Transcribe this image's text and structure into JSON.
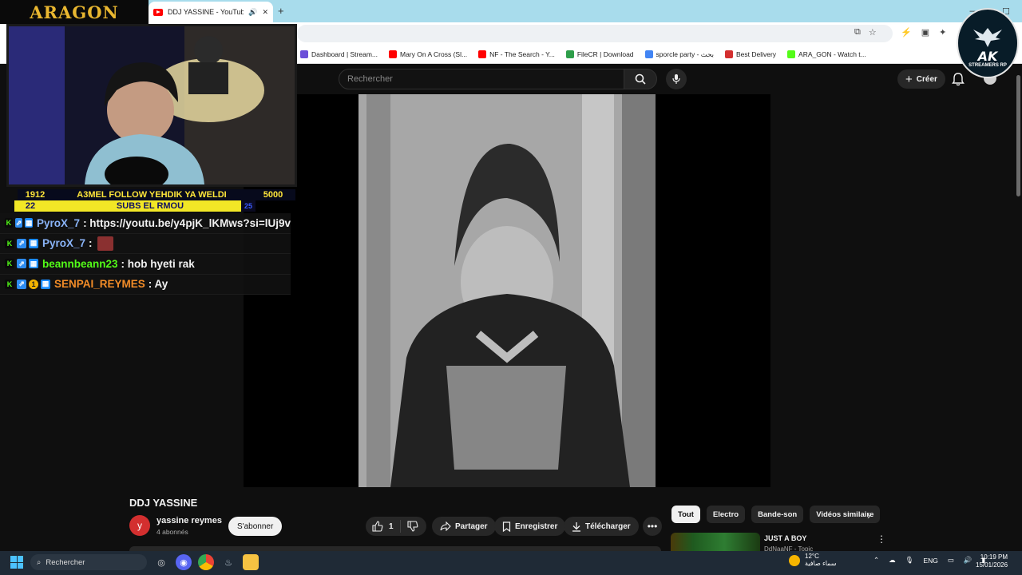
{
  "browser": {
    "tab_title": "DDJ YASSINE - YouTube",
    "bookmarks": [
      {
        "label": "Dashboard | Stream...",
        "color": "#6b4fd8"
      },
      {
        "label": "Mary On A Cross (Sl...",
        "color": "#ff0000"
      },
      {
        "label": "NF - The Search - Y...",
        "color": "#ff0000"
      },
      {
        "label": "FileCR | Download",
        "color": "#2e9e4a"
      },
      {
        "label": "sporcle party - بحث",
        "color": "#4285f4"
      },
      {
        "label": "Best Delivery",
        "color": "#d32f2f"
      },
      {
        "label": "ARA_GON - Watch t...",
        "color": "#53fc18"
      }
    ]
  },
  "youtube": {
    "search_placeholder": "Rechercher",
    "create_label": "Créer",
    "video_title": "DDJ YASSINE",
    "channel": {
      "initial": "y",
      "name": "yassine reymes",
      "subscribers": "4 abonnés"
    },
    "subscribe_label": "S'abonner",
    "like_count": "1",
    "share_label": "Partager",
    "save_label": "Enregistrer",
    "download_label": "Télécharger",
    "chips": [
      "Tout",
      "Electro",
      "Bande-son",
      "Vidéos similaire"
    ],
    "recommendation": {
      "title": "JUST A BOY",
      "subtitle": "DdNaaNF - Topic"
    }
  },
  "overlay": {
    "brand": "ARAGON",
    "goal": {
      "left_count": "1912",
      "text": "A3MEL FOLLOW YEHDIK YA WELDI",
      "target": "5000",
      "subs_count": "22",
      "subs_text": "SUBS EL RMOU",
      "subs_end": "25"
    },
    "chat": [
      {
        "user": "PyroX_7",
        "user_color": "#8ab4f8",
        "message": ": https://youtu.be/y4pjK_lKMws?si=lUj9v",
        "emote": false,
        "coin": false
      },
      {
        "user": "PyroX_7",
        "user_color": "#8ab4f8",
        "message": ":",
        "emote": true,
        "coin": false
      },
      {
        "user": "beannbeann23",
        "user_color": "#53fc18",
        "message": ": hob hyeti rak",
        "emote": false,
        "coin": false
      },
      {
        "user": "SENPAI_REYMES",
        "user_color": "#f28c28",
        "message": ": Ay",
        "emote": false,
        "coin": true
      }
    ],
    "logo": {
      "title": "AK",
      "subtitle": "STREAMERS RP"
    }
  },
  "taskbar": {
    "search_label": "Rechercher",
    "weather_temp": "12°C",
    "weather_text": "سماء صافية",
    "language": "ENG",
    "time": "10:19 PM",
    "date": "15/01/2026"
  }
}
